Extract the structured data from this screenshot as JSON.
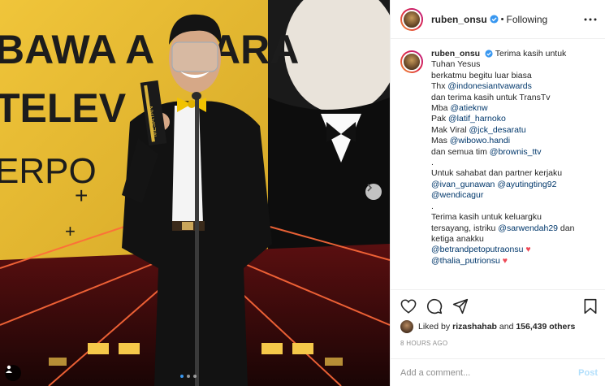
{
  "photo": {
    "backdrop_text": [
      "BAWA A",
      "ARA",
      "TELEV",
      "ERPO"
    ],
    "trophy_text": "MESAYAN",
    "carousel_dots": 3,
    "active_dot": 1
  },
  "post_header": {
    "username": "ruben_onsu",
    "separator": "•",
    "follow_status": "Following"
  },
  "caption": {
    "username": "ruben_onsu",
    "lines": [
      [
        {
          "t": "Terima kasih untuk",
          "m": false
        }
      ],
      [
        {
          "t": "Tuhan Yesus",
          "m": false
        }
      ],
      [
        {
          "t": "berkatmu begitu luar biasa",
          "m": false
        }
      ],
      [
        {
          "t": "Thx ",
          "m": false
        },
        {
          "t": "@indonesiantvawards",
          "m": true
        }
      ],
      [
        {
          "t": "dan terima kasih untuk TransTv",
          "m": false
        }
      ],
      [
        {
          "t": "Mba ",
          "m": false
        },
        {
          "t": "@atieknw",
          "m": true
        }
      ],
      [
        {
          "t": "Pak ",
          "m": false
        },
        {
          "t": "@latif_harnoko",
          "m": true
        }
      ],
      [
        {
          "t": "Mak Viral ",
          "m": false
        },
        {
          "t": "@jck_desaratu",
          "m": true
        }
      ],
      [
        {
          "t": "Mas ",
          "m": false
        },
        {
          "t": "@wibowo.handi",
          "m": true
        }
      ],
      [
        {
          "t": "dan semua tim ",
          "m": false
        },
        {
          "t": "@brownis_ttv",
          "m": true
        }
      ],
      [
        {
          "t": ".",
          "m": false
        }
      ],
      [
        {
          "t": "Untuk sahabat dan partner kerjaku",
          "m": false
        }
      ],
      [
        {
          "t": "@ivan_gunawan",
          "m": true
        },
        {
          "t": " ",
          "m": false
        },
        {
          "t": "@ayutingting92",
          "m": true
        }
      ],
      [
        {
          "t": "@wendicagur",
          "m": true
        }
      ],
      [
        {
          "t": ".",
          "m": false
        }
      ],
      [
        {
          "t": "Terima kasih untuk keluargku",
          "m": false
        }
      ],
      [
        {
          "t": "tersayang, istriku ",
          "m": false
        },
        {
          "t": "@sarwendah29",
          "m": true
        },
        {
          "t": " dan",
          "m": false
        }
      ],
      [
        {
          "t": "ketiga anakku",
          "m": false
        }
      ],
      [
        {
          "t": "@betrandpetoputraonsu",
          "m": true
        },
        {
          "t": " ♥",
          "m": false,
          "h": true
        }
      ],
      [
        {
          "t": "@thalia_putrionsu",
          "m": true
        },
        {
          "t": " ♥",
          "m": false,
          "h": true
        }
      ]
    ]
  },
  "actions": {
    "icons": [
      "heart-icon",
      "comment-icon",
      "share-icon",
      "bookmark-icon"
    ]
  },
  "likes": {
    "prefix": "Liked by ",
    "user": "rizashahab",
    "middle": " and ",
    "count": "156,439 others"
  },
  "timestamp": "8 HOURS AGO",
  "comment_box": {
    "placeholder": "Add a comment...",
    "post_label": "Post"
  },
  "colors": {
    "accent_link": "#00376b",
    "verified_blue": "#3897f0",
    "heart_red": "#ed4956",
    "stage_yellow": "#d9b02a"
  }
}
